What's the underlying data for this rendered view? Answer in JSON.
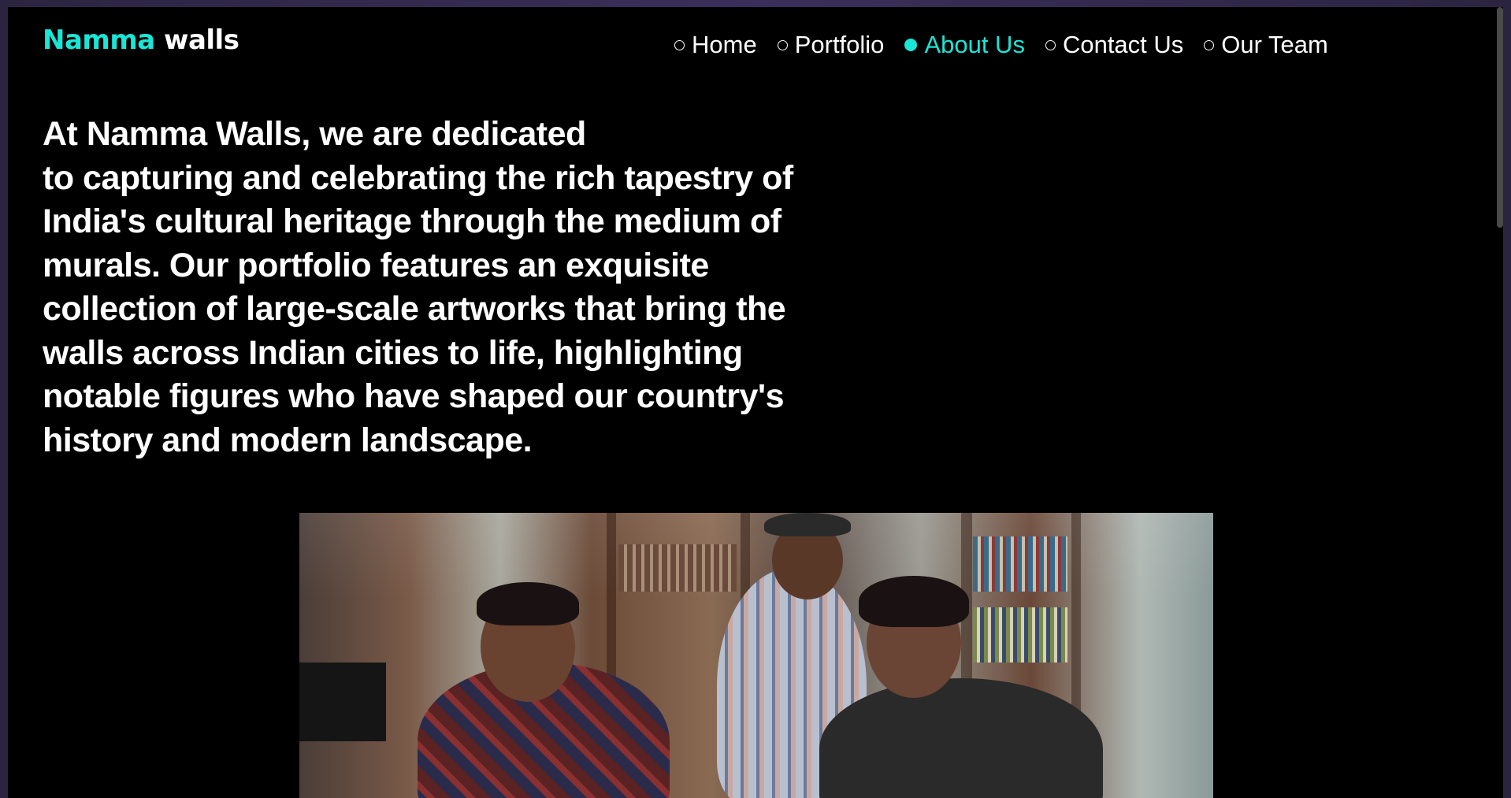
{
  "brand": {
    "logo_part1": "Namma",
    "logo_part2": "walls",
    "accent_color": "#19e6d6"
  },
  "nav": {
    "items": [
      {
        "label": "Home",
        "active": false
      },
      {
        "label": "Portfolio",
        "active": false
      },
      {
        "label": "About Us",
        "active": true
      },
      {
        "label": "Contact Us",
        "active": false
      },
      {
        "label": "Our Team",
        "active": false
      }
    ]
  },
  "about": {
    "line1": "At Namma Walls, we are dedicated",
    "rest": "to capturing and celebrating the rich tapestry of India's cultural heritage through the medium of murals. Our portfolio features an exquisite collection of large-scale artworks that bring the walls across Indian cities to life, highlighting notable figures who have shaped our country's history and modern landscape."
  },
  "icons": {
    "nav_bullet": "radio-dot-icon"
  }
}
